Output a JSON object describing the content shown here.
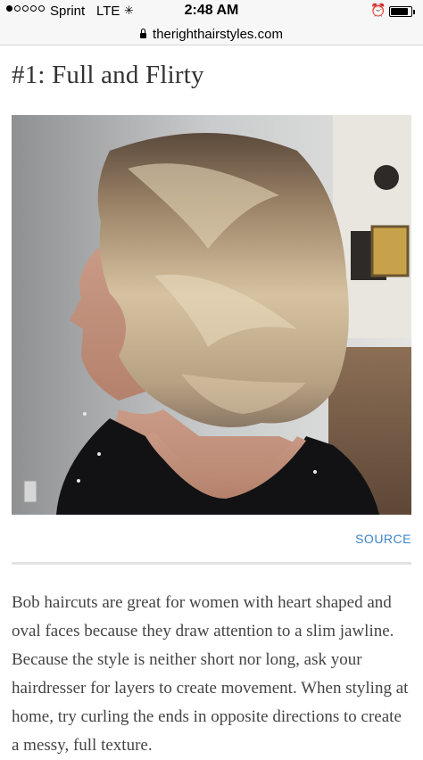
{
  "status_bar": {
    "carrier": "Sprint",
    "network": "LTE",
    "time": "2:48 AM",
    "signal_bars_filled": 1,
    "signal_bars_total": 5,
    "battery_level": 0.85,
    "icons": [
      "activity-spinner-icon",
      "alarm-clock-icon",
      "battery-icon",
      "lock-icon"
    ]
  },
  "browser": {
    "url": "therighthairstyles.com"
  },
  "article": {
    "title": "#1: Full and Flirty",
    "image_alt": "woman with layered blonde balayage bob",
    "source_link": "SOURCE",
    "body": "Bob haircuts are great for women with heart shaped and oval faces because they draw attention to a slim jawline. Because the style is neither short nor long, ask your hairdresser for layers to create movement. When styling at home, try curling the ends in opposite directions to create a messy, full texture."
  },
  "colors": {
    "link": "#3d85c6",
    "title": "#333333",
    "body_text": "#444444"
  }
}
